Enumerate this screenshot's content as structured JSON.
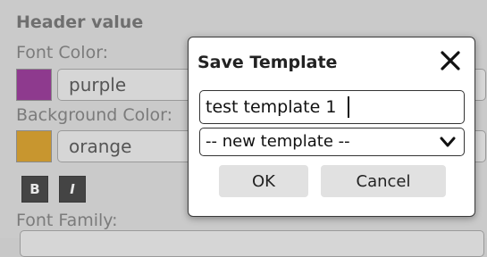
{
  "panel": {
    "header": "Header value",
    "font_color_label": "Font Color:",
    "font_color_value": "purple",
    "font_color_swatch": "#8e3a8e",
    "background_color_label": "Background Color:",
    "background_color_value": "orange",
    "background_color_swatch": "#c8962f",
    "bold_label": "B",
    "italic_label": "I",
    "font_family_label": "Font Family:"
  },
  "modal": {
    "title": "Save Template",
    "close_icon": "close-icon",
    "name_input_value": "test template 1",
    "template_select_value": "-- new template --",
    "ok_label": "OK",
    "cancel_label": "Cancel"
  }
}
